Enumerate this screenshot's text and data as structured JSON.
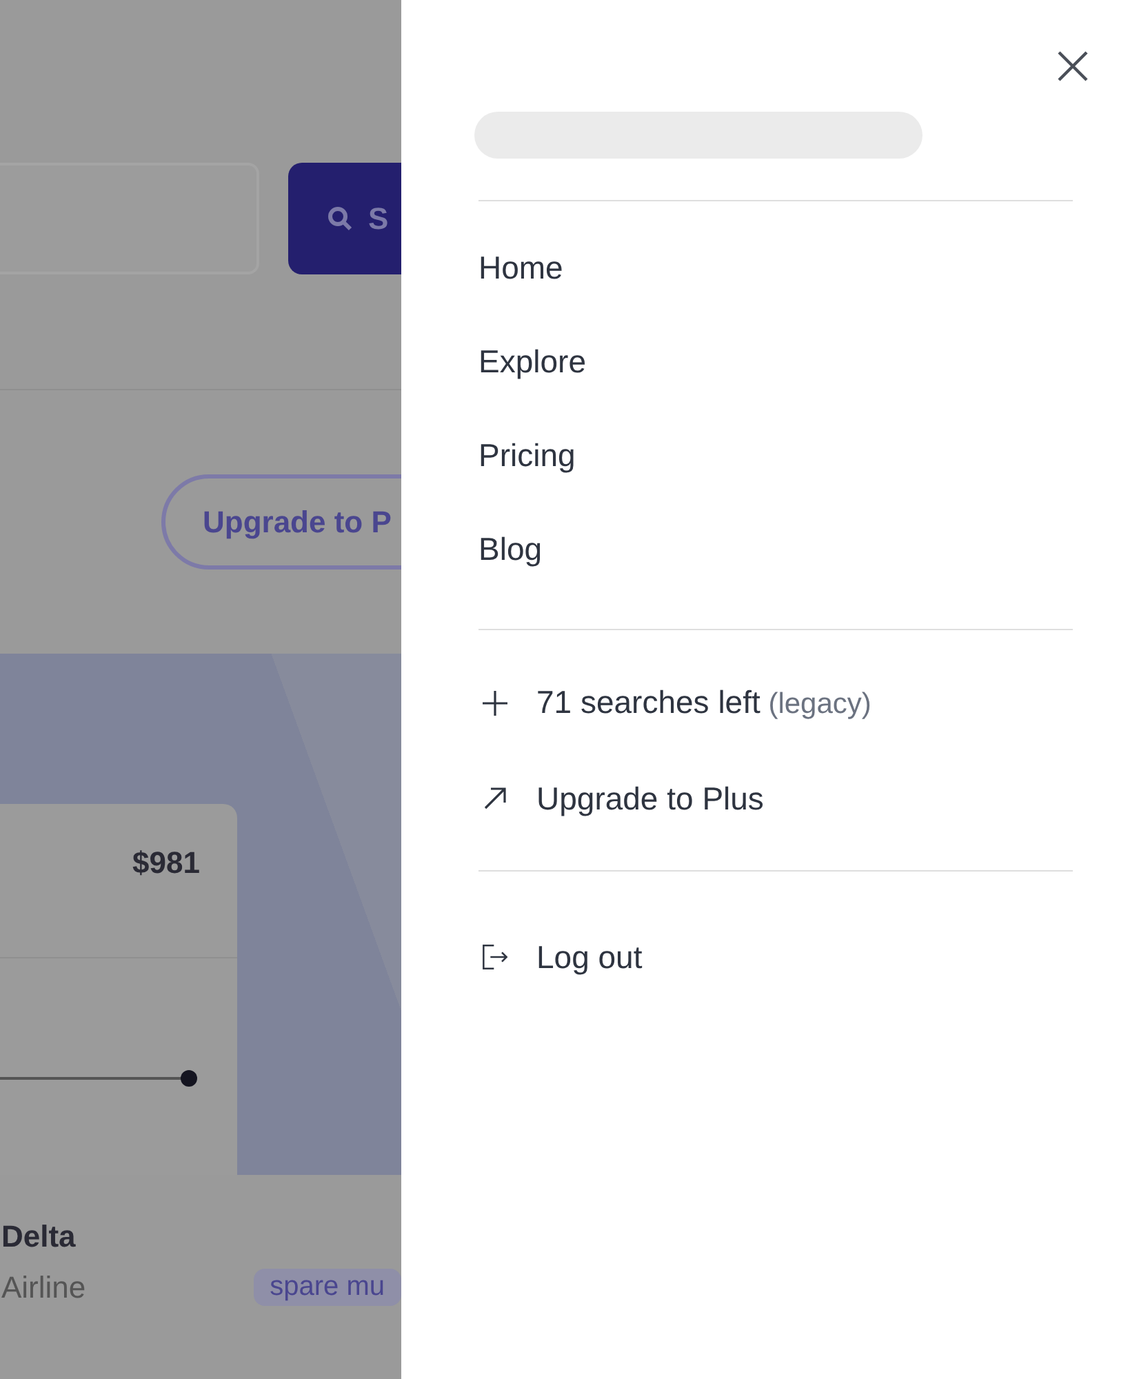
{
  "background": {
    "search_button": {
      "label": "S"
    },
    "upgrade_button": {
      "label": "Upgrade to P"
    },
    "price_card": {
      "price": "$981"
    },
    "result": {
      "airline": "Delta",
      "type": "Airline",
      "tag": "spare mu"
    }
  },
  "drawer": {
    "nav_items": [
      {
        "label": "Home"
      },
      {
        "label": "Explore"
      },
      {
        "label": "Pricing"
      },
      {
        "label": "Blog"
      }
    ],
    "account_items": [
      {
        "kind": "searches",
        "label": "71 searches left",
        "note": "(legacy)"
      },
      {
        "kind": "upgrade",
        "label": "Upgrade to Plus"
      }
    ],
    "logout": {
      "label": "Log out"
    }
  }
}
